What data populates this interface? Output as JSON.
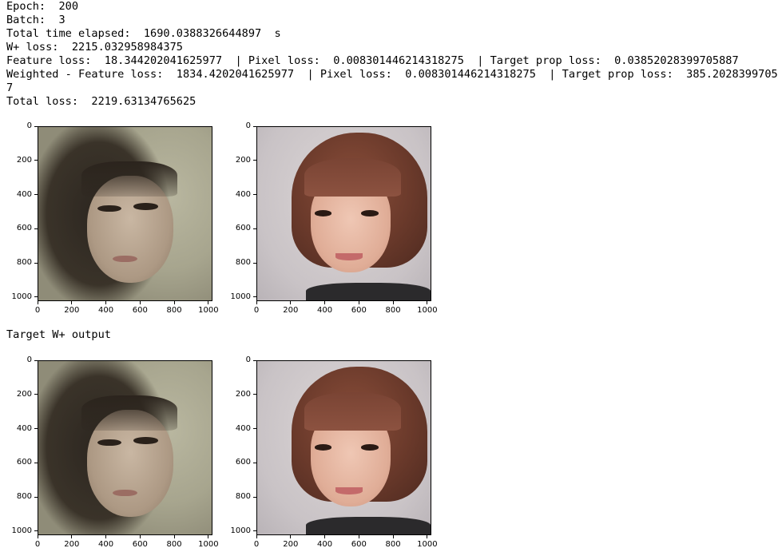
{
  "log": {
    "lines": [
      "Epoch:  200",
      "Batch:  3",
      "Total time elapsed:  1690.0388326644897  s",
      "W+ loss:  2215.032958984375",
      "Feature loss:  18.344202041625977  | Pixel loss:  0.008301446214318275  | Target prop loss:  0.03852028399705887",
      "Weighted - Feature loss:  1834.4202041625977  | Pixel loss:  0.008301446214318275  | Target prop loss:  385.202839970588",
      "7",
      "Total loss:  2219.63134765625"
    ]
  },
  "caption": "Target W+ output",
  "axes": {
    "y_ticks": [
      "0",
      "200",
      "400",
      "600",
      "800",
      "1000"
    ],
    "x_ticks": [
      "0",
      "200",
      "400",
      "600",
      "800",
      "1000"
    ]
  },
  "plots": [
    {
      "subject": "dark-haired woman"
    },
    {
      "subject": "bob-haired woman"
    },
    {
      "subject": "dark-haired woman"
    },
    {
      "subject": "bob-haired woman"
    }
  ]
}
